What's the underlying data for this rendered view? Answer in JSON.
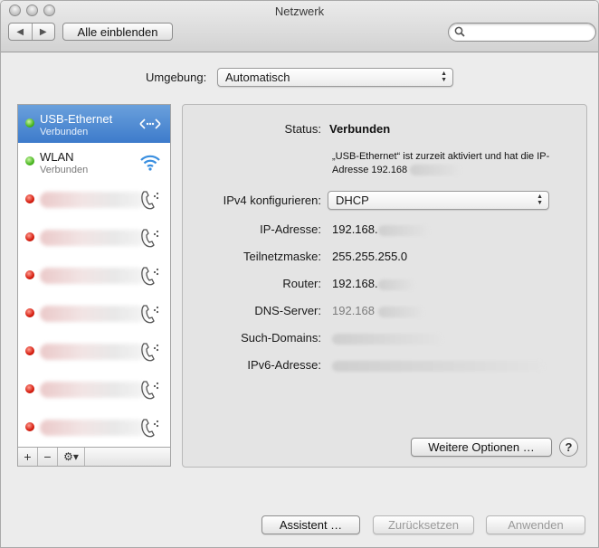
{
  "window": {
    "title": "Netzwerk"
  },
  "toolbar": {
    "back_icon": "◀",
    "forward_icon": "▶",
    "show_all": "Alle einblenden",
    "search_placeholder": ""
  },
  "location": {
    "label": "Umgebung:",
    "value": "Automatisch"
  },
  "services": [
    {
      "name": "USB-Ethernet",
      "status": "Verbunden",
      "dot": "green",
      "icon": "ethernet-icon",
      "selected": true
    },
    {
      "name": "WLAN",
      "status": "Verbunden",
      "dot": "green",
      "icon": "wifi-icon",
      "selected": false
    },
    {
      "dot": "red",
      "icon": "modem-icon"
    },
    {
      "dot": "red",
      "icon": "modem-icon"
    },
    {
      "dot": "red",
      "icon": "modem-icon"
    },
    {
      "dot": "red",
      "icon": "modem-icon"
    },
    {
      "dot": "red",
      "icon": "modem-icon"
    },
    {
      "dot": "red",
      "icon": "modem-icon"
    },
    {
      "dot": "red",
      "icon": "modem-icon"
    }
  ],
  "sidebar_bar": {
    "add": "+",
    "remove": "−",
    "gear": "⚙▾"
  },
  "detail": {
    "status_label": "Status:",
    "status_value": "Verbunden",
    "description_line1": "„USB-Ethernet“ ist zurzeit aktiviert und hat die IP-",
    "description_line2": "Adresse 192.168",
    "ipv4_label": "IPv4 konfigurieren:",
    "ipv4_value": "DHCP",
    "ip_label": "IP-Adresse:",
    "ip_value": "192.168.",
    "subnet_label": "Teilnetzmaske:",
    "subnet_value": "255.255.255.0",
    "router_label": "Router:",
    "router_value": "192.168.",
    "dns_label": "DNS-Server:",
    "dns_value": "192.168",
    "search_domains_label": "Such-Domains:",
    "ipv6_label": "IPv6-Adresse:",
    "advanced_button": "Weitere Optionen …",
    "help_button": "?"
  },
  "footer": {
    "assistant": "Assistent …",
    "revert": "Zurücksetzen",
    "apply": "Anwenden"
  },
  "colors": {
    "selection": "#3d7bcb",
    "connected": "#47b61e",
    "disconnected": "#d51b0d"
  }
}
